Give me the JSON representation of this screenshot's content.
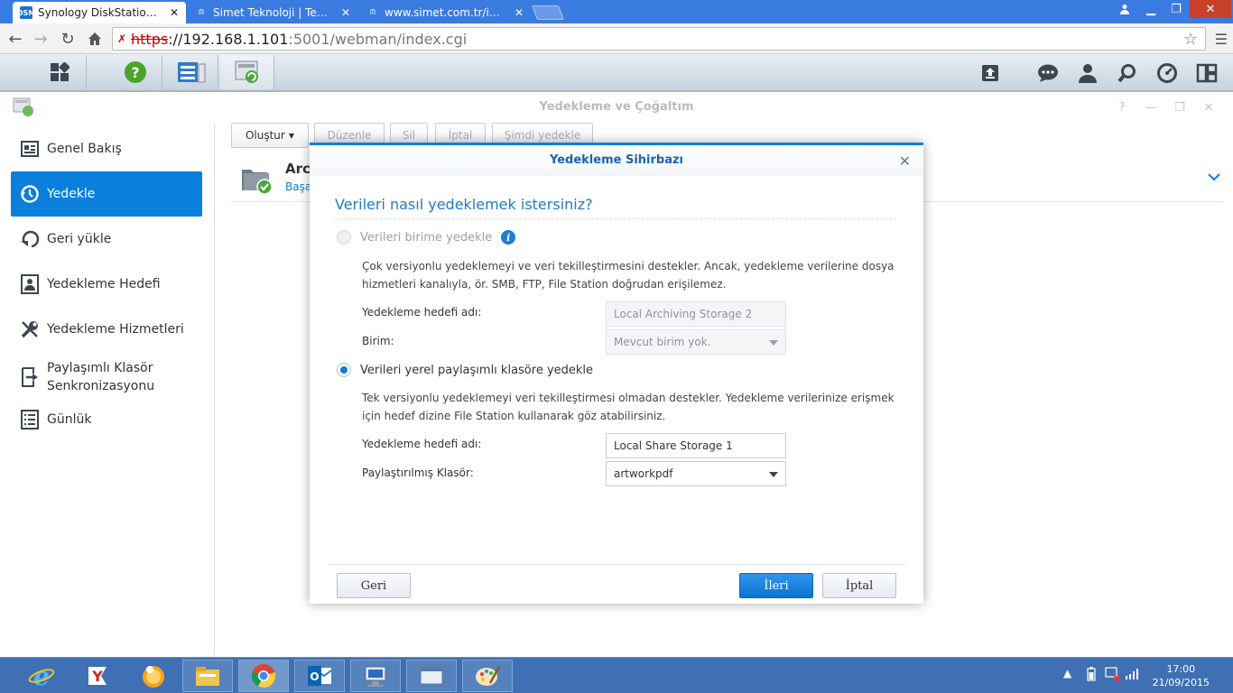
{
  "browser": {
    "tabs": [
      {
        "title": "Synology DiskStation - ve",
        "favicon": "DSM"
      },
      {
        "title": "Simet Teknoloji | Teknik D"
      },
      {
        "title": "www.simet.com.tr/index.cf"
      }
    ],
    "url": {
      "scheme": "https",
      "host": "://192.168.1.101",
      "path": ":5001/webman/index.cgi"
    }
  },
  "app": {
    "title": "Yedekleme ve Çoğaltım",
    "sidebar": [
      {
        "label": "Genel Bakış",
        "icon": "overview-icon"
      },
      {
        "label": "Yedekle",
        "icon": "backup-clock-icon"
      },
      {
        "label": "Geri yükle",
        "icon": "restore-icon"
      },
      {
        "label": "Yedekleme Hedefi",
        "icon": "destination-icon"
      },
      {
        "label": "Yedekleme Hizmetleri",
        "icon": "wrench-icon"
      },
      {
        "label": "Paylaşımlı Klasör Senkronizasyonu",
        "icon": "sync-icon"
      },
      {
        "label": "Günlük",
        "icon": "log-icon"
      }
    ],
    "toolbar": {
      "create": "Oluştur",
      "edit": "Düzenle",
      "delete": "Sil",
      "cancel": "İptal",
      "backup_now": "Şimdi yedekle"
    },
    "task": {
      "name": "Arc",
      "status": "Başa"
    }
  },
  "wizard": {
    "title": "Yedekleme Sihirbazı",
    "question": "Verileri nasıl yedeklemek istersiniz?",
    "option1": {
      "label": "Verileri birime yedekle",
      "desc1": "Çok versiyonlu yedeklemeyi ve veri tekilleştirmesini destekler. Ancak, yedekleme verilerine dosya",
      "desc2": "hizmetleri kanalıyla, ör. SMB, FTP, File Station doğrudan erişilemez.",
      "target_label": "Yedekleme hedefi adı:",
      "target_value": "Local Archiving Storage 2",
      "volume_label": "Birim:",
      "volume_value": "Mevcut birim yok."
    },
    "option2": {
      "label": "Verileri yerel paylaşımlı klasöre yedekle",
      "desc1": "Tek versiyonlu yedeklemeyi veri tekilleştirmesi olmadan destekler. Yedekleme verilerinize erişmek",
      "desc2": "için hedef dizine File Station kullanarak göz atabilirsiniz.",
      "target_label": "Yedekleme hedefi adı:",
      "target_value": "Local Share Storage 1",
      "folder_label": "Paylaştırılmış Klasör:",
      "folder_value": "artworkpdf"
    },
    "buttons": {
      "back": "Geri",
      "next": "İleri",
      "cancel": "İptal"
    }
  },
  "taskbar": {
    "time": "17:00",
    "date": "21/09/2015"
  },
  "colors": {
    "accent": "#0a7fdb",
    "taskbar": "#3e70b3",
    "tabstrip": "#3a7be0"
  }
}
